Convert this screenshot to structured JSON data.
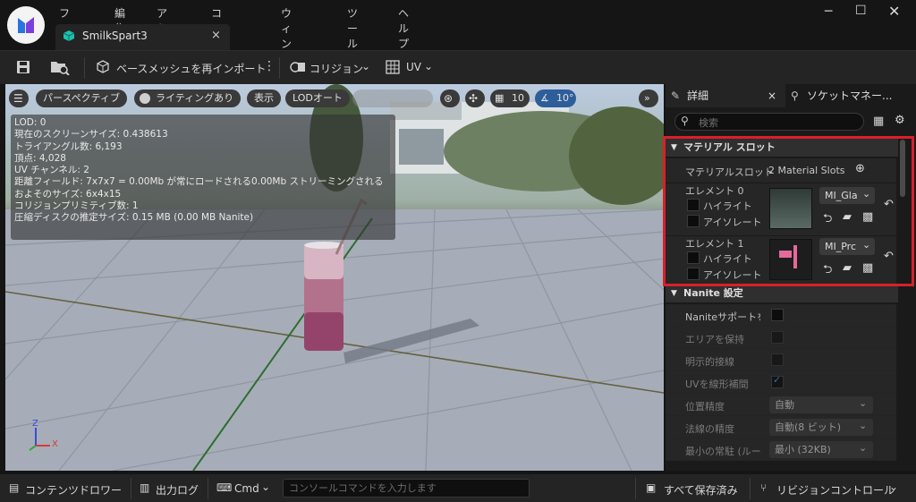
{
  "menu": [
    "ファイル",
    "編集",
    "アセット",
    "コリジョン",
    "ウィンドウ",
    "ツール",
    "ヘルプ"
  ],
  "tab": {
    "title": "SmilkSpart3",
    "close": "×"
  },
  "toolbar": {
    "reimport": "ベースメッシュを再インポート",
    "collision": "コリジョン",
    "uv": "UV"
  },
  "viewport": {
    "perspective": "パースペクティブ",
    "lighting": "ライティングあり",
    "show": "表示",
    "lod": "LODオート",
    "grid_value": "10",
    "angle_value": "10°",
    "stats": [
      "LOD: 0",
      "現在のスクリーンサイズ: 0.438613",
      "トライアングル数: 6,193",
      "頂点: 4,028",
      "UV チャンネル: 2",
      "距離フィールド: 7x7x7 = 0.00Mb が常にロードされる0.00Mb ストリーミングされる",
      "およそのサイズ: 6x4x15",
      "コリジョンプリミティブ数: 1",
      "圧縮ディスクの推定サイズ: 0.15 MB (0.00 MB Nanite)"
    ],
    "axis": {
      "z": "Z",
      "x": "X"
    }
  },
  "panel": {
    "details_tab": "詳細",
    "sockets_tab": "ソケットマネー...",
    "close": "×",
    "search_placeholder": "検索",
    "material_section": "マテリアル スロット",
    "material_slots_label": "マテリアルスロット",
    "material_slots_value": "2 Material Slots",
    "elements": [
      {
        "name": "エレメント 0",
        "highlight": "ハイライト",
        "isolate": "アイソレート",
        "material": "MI_Gla"
      },
      {
        "name": "エレメント 1",
        "highlight": "ハイライト",
        "isolate": "アイソレート",
        "material": "MI_Prc"
      }
    ],
    "nanite_section": "Nanite 設定",
    "nanite_rows": [
      {
        "label": "Naniteサポートを有",
        "type": "check",
        "checked": false
      },
      {
        "label": "エリアを保持",
        "type": "check",
        "checked": false
      },
      {
        "label": "明示的接線",
        "type": "check",
        "checked": false
      },
      {
        "label": "UVを線形補間",
        "type": "check",
        "checked": true
      },
      {
        "label": "位置精度",
        "type": "select",
        "value": "自動"
      },
      {
        "label": "法線の精度",
        "type": "select",
        "value": "自動(8 ビット)"
      },
      {
        "label": "最小の常駐 (ルート",
        "type": "select",
        "value": "最小 (32KB)"
      }
    ]
  },
  "statusbar": {
    "content_drawer": "コンテンツドロワー",
    "output_log": "出力ログ",
    "cmd": "Cmd",
    "console_placeholder": "コンソールコマンドを入力します",
    "save_all": "すべて保存済み",
    "revision": "リビジョンコントロール"
  },
  "colors": {
    "accent": "#0a84e0",
    "highlight_box": "#d8202a",
    "checkmark": "#2f8fe0"
  }
}
